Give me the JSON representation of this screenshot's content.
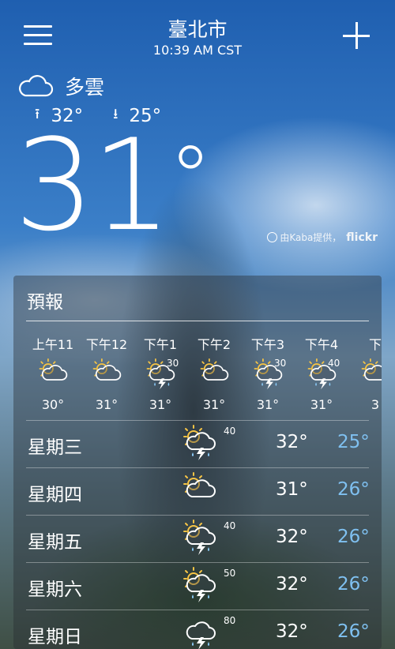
{
  "header": {
    "city": "臺北市",
    "time": "10:39 AM CST"
  },
  "current": {
    "condition": "多雲",
    "high": "32°",
    "low": "25°",
    "temp": "31",
    "degree": "°"
  },
  "photo_credit": {
    "text": "由Kaba提供，",
    "brand": "flickr"
  },
  "forecast": {
    "title": "預報",
    "hourly": [
      {
        "label": "上午11",
        "icon": "partly-sunny-icon",
        "pct": "",
        "temp": "30°"
      },
      {
        "label": "下午12",
        "icon": "partly-sunny-icon",
        "pct": "",
        "temp": "31°"
      },
      {
        "label": "下午1",
        "icon": "thunderstorm-sun-icon",
        "pct": "30",
        "temp": "31°"
      },
      {
        "label": "下午2",
        "icon": "partly-sunny-icon",
        "pct": "",
        "temp": "31°"
      },
      {
        "label": "下午3",
        "icon": "thunderstorm-sun-icon",
        "pct": "30",
        "temp": "31°"
      },
      {
        "label": "下午4",
        "icon": "thunderstorm-sun-icon",
        "pct": "40",
        "temp": "31°"
      },
      {
        "label": "下",
        "icon": "partly-sunny-icon",
        "pct": "",
        "temp": "3"
      }
    ],
    "daily": [
      {
        "day": "星期三",
        "icon": "thunderstorm-sun-icon",
        "pct": "40",
        "high": "32°",
        "low": "25°"
      },
      {
        "day": "星期四",
        "icon": "partly-sunny-icon",
        "pct": "",
        "high": "31°",
        "low": "26°"
      },
      {
        "day": "星期五",
        "icon": "thunderstorm-sun-icon",
        "pct": "40",
        "high": "32°",
        "low": "26°"
      },
      {
        "day": "星期六",
        "icon": "thunderstorm-sun-icon",
        "pct": "50",
        "high": "32°",
        "low": "26°"
      },
      {
        "day": "星期日",
        "icon": "thunderstorm-icon",
        "pct": "80",
        "high": "32°",
        "low": "26°"
      }
    ]
  },
  "colors": {
    "low_temp": "#7fc0f0",
    "sun": "#f6c445"
  }
}
